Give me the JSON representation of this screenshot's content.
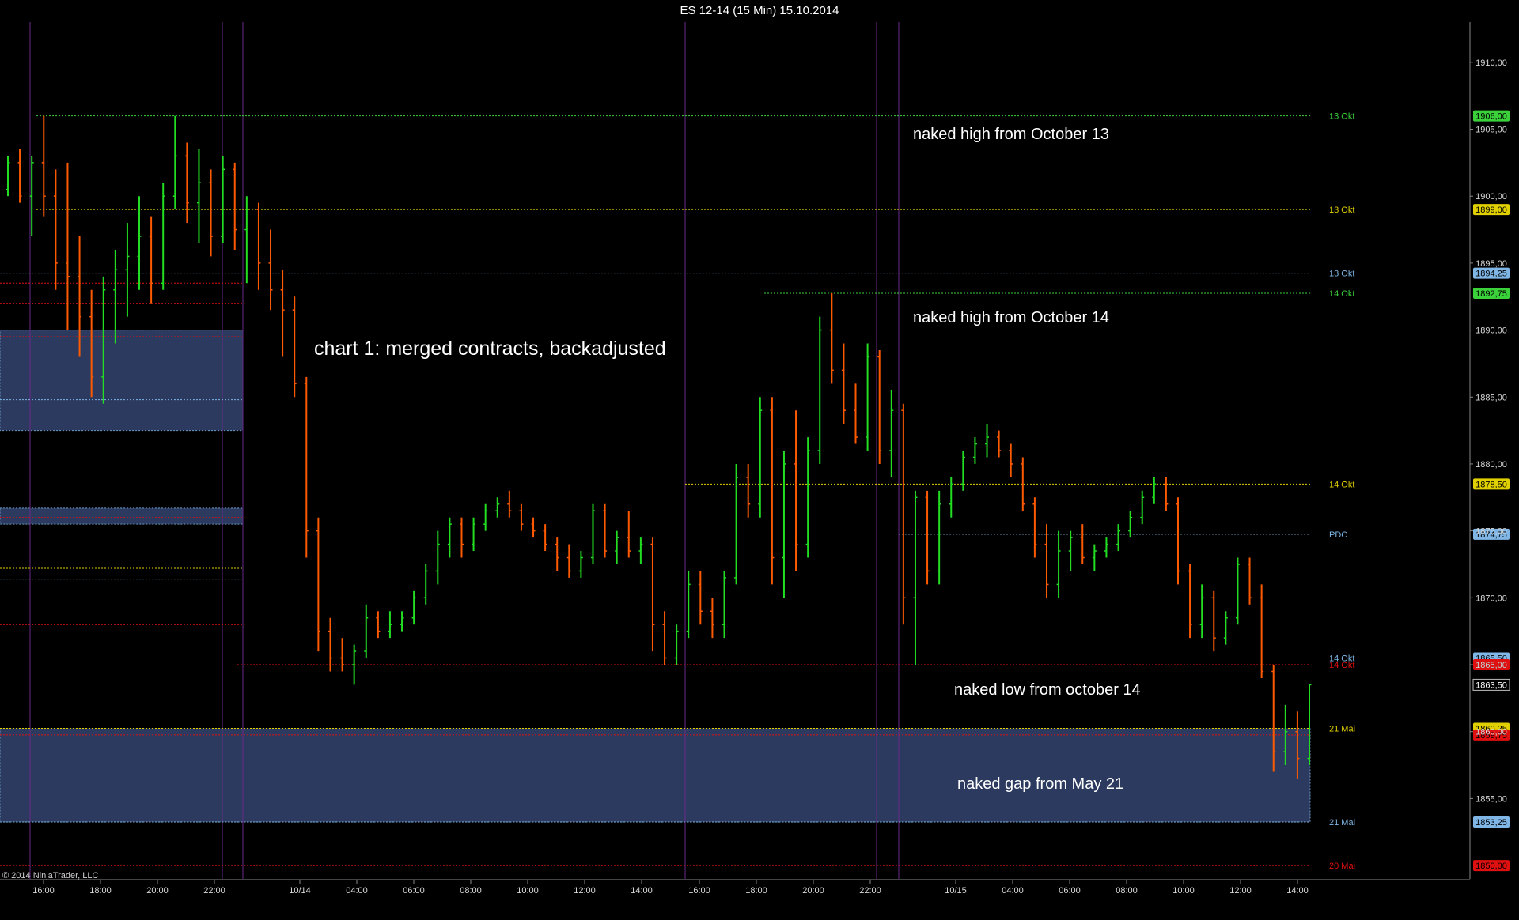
{
  "window": {
    "title": "ES 12-14 (15 Min)  15.10.2014"
  },
  "copyright": "© 2014 NinjaTrader, LLC",
  "colors": {
    "background": "#000000",
    "up_bar": "#22dd22",
    "down_bar": "#ff5a00",
    "neutral_bar": "#ffffff",
    "zone_fill": "#2b3a5e",
    "session_divider": "#6a2a8a",
    "green_level": "#3bd13b",
    "yellow_level": "#e0d000",
    "blue_level": "#7fb6e6",
    "red_level": "#e01010"
  },
  "annotations": {
    "chart_label": "chart 1: merged contracts, backadjusted",
    "naked_high_13": "naked high from October 13",
    "naked_high_14": "naked high from October 14",
    "naked_low_14": "naked low from october 14",
    "naked_gap_may21": "naked gap from May 21"
  },
  "chart_data": {
    "type": "bar",
    "instrument": "ES 12-14",
    "interval": "15 Min",
    "date": "15.10.2014",
    "ylim": [
      1849,
      1913
    ],
    "y_ticks": [
      "1910,00",
      "1905,00",
      "1900,00",
      "1895,00",
      "1890,00",
      "1885,00",
      "1880,00",
      "1875,00",
      "1870,00",
      "1865,00",
      "1860,00",
      "1855,00"
    ],
    "y_tick_values": [
      1910,
      1905,
      1900,
      1895,
      1890,
      1885,
      1880,
      1875,
      1870,
      1865,
      1860,
      1855
    ],
    "x_ticks": [
      "16:00",
      "18:00",
      "20:00",
      "22:00",
      "10/14",
      "04:00",
      "06:00",
      "08:00",
      "10:00",
      "12:00",
      "14:00",
      "16:00",
      "18:00",
      "20:00",
      "22:00",
      "10/15",
      "04:00",
      "06:00",
      "08:00",
      "10:00",
      "12:00",
      "14:00"
    ],
    "levels": [
      {
        "price": 1906.0,
        "label": "13 Okt",
        "price_label": "1906,00",
        "color": "green"
      },
      {
        "price": 1899.0,
        "label": "13 Okt",
        "price_label": "1899,00",
        "color": "yellow"
      },
      {
        "price": 1894.25,
        "label": "13 Okt",
        "price_label": "1894,25",
        "color": "blue"
      },
      {
        "price": 1892.75,
        "label": "14 Okt",
        "price_label": "1892,75",
        "color": "green"
      },
      {
        "price": 1878.5,
        "label": "14 Okt",
        "price_label": "1878,50",
        "color": "yellow"
      },
      {
        "price": 1874.75,
        "label": "PDC",
        "price_label": "1874,75",
        "color": "blue"
      },
      {
        "price": 1865.5,
        "label": "14 Okt",
        "price_label": "1865,50",
        "color": "blue"
      },
      {
        "price": 1865.0,
        "label": "14 Okt",
        "price_label": "1865,00",
        "color": "red"
      },
      {
        "price": 1860.25,
        "label": "21 Mai",
        "price_label": "1860,25",
        "color": "yellow"
      },
      {
        "price": 1859.75,
        "label": "",
        "price_label": "1859,75",
        "color": "red"
      },
      {
        "price": 1853.25,
        "label": "21 Mai",
        "price_label": "1853,25",
        "color": "blue"
      },
      {
        "price": 1850.0,
        "label": "20 Mai",
        "price_label": "1850,00",
        "color": "red"
      }
    ],
    "last_price": 1863.5,
    "last_price_label": "1863,50",
    "zones": [
      {
        "from": 1882.5,
        "to": 1890.0
      },
      {
        "from": 1875.5,
        "to": 1876.7
      },
      {
        "from": 1853.25,
        "to": 1860.25
      }
    ],
    "ohlc": [
      [
        1900.5,
        1903.0,
        1900.0,
        1902.5
      ],
      [
        1902.5,
        1903.5,
        1899.5,
        1900.0
      ],
      [
        1900.0,
        1903.0,
        1897.0,
        1902.5
      ],
      [
        1902.5,
        1906.0,
        1898.5,
        1900.0
      ],
      [
        1900.0,
        1902.0,
        1893.0,
        1895.0
      ],
      [
        1895.0,
        1902.5,
        1890.0,
        1894.0
      ],
      [
        1894.0,
        1897.0,
        1888.0,
        1891.0
      ],
      [
        1891.0,
        1893.0,
        1885.0,
        1886.5
      ],
      [
        1886.5,
        1894.0,
        1884.5,
        1893.0
      ],
      [
        1893.0,
        1896.0,
        1889.0,
        1894.5
      ],
      [
        1894.5,
        1898.0,
        1891.0,
        1895.5
      ],
      [
        1895.5,
        1900.0,
        1893.0,
        1897.0
      ],
      [
        1897.0,
        1898.5,
        1892.0,
        1893.5
      ],
      [
        1893.5,
        1901.0,
        1893.0,
        1900.0
      ],
      [
        1900.0,
        1906.0,
        1899.0,
        1903.0
      ],
      [
        1903.0,
        1904.0,
        1898.0,
        1899.5
      ],
      [
        1899.5,
        1903.5,
        1896.5,
        1901.0
      ],
      [
        1901.0,
        1902.0,
        1895.5,
        1897.0
      ],
      [
        1897.0,
        1903.0,
        1896.5,
        1902.0
      ],
      [
        1902.0,
        1902.5,
        1896.0,
        1897.5
      ],
      [
        1897.5,
        1900.0,
        1893.5,
        1899.0
      ],
      [
        1899.0,
        1899.5,
        1893.0,
        1895.0
      ],
      [
        1895.0,
        1897.5,
        1891.5,
        1893.0
      ],
      [
        1893.0,
        1894.5,
        1888.0,
        1891.5
      ],
      [
        1891.5,
        1892.5,
        1885.0,
        1886.0
      ],
      [
        1886.0,
        1886.5,
        1873.0,
        1875.0
      ],
      [
        1875.0,
        1876.0,
        1866.0,
        1867.5
      ],
      [
        1867.5,
        1868.5,
        1864.5,
        1865.5
      ],
      [
        1865.5,
        1867.0,
        1864.5,
        1865.0
      ],
      [
        1865.0,
        1866.5,
        1863.5,
        1866.0
      ],
      [
        1866.0,
        1869.5,
        1865.5,
        1868.5
      ],
      [
        1868.5,
        1869.0,
        1867.0,
        1867.5
      ],
      [
        1867.5,
        1869.0,
        1867.0,
        1868.0
      ],
      [
        1868.0,
        1869.0,
        1867.5,
        1868.5
      ],
      [
        1868.5,
        1870.5,
        1868.0,
        1870.0
      ],
      [
        1870.0,
        1872.5,
        1869.5,
        1872.0
      ],
      [
        1872.0,
        1875.0,
        1871.0,
        1874.0
      ],
      [
        1874.0,
        1876.0,
        1873.0,
        1875.5
      ],
      [
        1875.5,
        1876.0,
        1873.0,
        1874.0
      ],
      [
        1874.0,
        1876.0,
        1873.5,
        1875.5
      ],
      [
        1875.5,
        1877.0,
        1875.0,
        1876.5
      ],
      [
        1876.5,
        1877.5,
        1876.0,
        1877.0
      ],
      [
        1877.0,
        1878.0,
        1876.0,
        1876.5
      ],
      [
        1876.5,
        1877.0,
        1875.0,
        1875.5
      ],
      [
        1875.5,
        1876.0,
        1874.5,
        1875.0
      ],
      [
        1875.0,
        1875.5,
        1873.5,
        1874.0
      ],
      [
        1874.0,
        1874.5,
        1872.0,
        1873.0
      ],
      [
        1873.0,
        1874.0,
        1871.5,
        1872.0
      ],
      [
        1872.0,
        1873.5,
        1871.5,
        1873.0
      ],
      [
        1873.0,
        1877.0,
        1872.5,
        1876.5
      ],
      [
        1876.5,
        1877.0,
        1873.0,
        1873.5
      ],
      [
        1873.5,
        1875.0,
        1872.5,
        1874.5
      ],
      [
        1874.5,
        1876.5,
        1873.0,
        1873.5
      ],
      [
        1873.5,
        1874.5,
        1872.5,
        1874.0
      ],
      [
        1874.0,
        1874.5,
        1866.0,
        1868.0
      ],
      [
        1868.0,
        1869.0,
        1865.0,
        1865.5
      ],
      [
        1865.5,
        1868.0,
        1865.0,
        1867.5
      ],
      [
        1867.5,
        1872.0,
        1867.0,
        1871.0
      ],
      [
        1871.0,
        1872.0,
        1868.0,
        1869.0
      ],
      [
        1869.0,
        1870.0,
        1867.0,
        1868.0
      ],
      [
        1868.0,
        1872.0,
        1867.0,
        1871.5
      ],
      [
        1871.5,
        1880.0,
        1871.0,
        1879.0
      ],
      [
        1879.0,
        1880.0,
        1876.0,
        1877.0
      ],
      [
        1877.0,
        1885.0,
        1876.0,
        1884.0
      ],
      [
        1884.0,
        1885.0,
        1871.0,
        1873.0
      ],
      [
        1873.0,
        1881.0,
        1870.0,
        1880.0
      ],
      [
        1880.0,
        1884.0,
        1872.0,
        1874.0
      ],
      [
        1874.0,
        1882.0,
        1873.0,
        1881.0
      ],
      [
        1881.0,
        1891.0,
        1880.0,
        1890.0
      ],
      [
        1890.0,
        1892.75,
        1886.0,
        1887.0
      ],
      [
        1887.0,
        1889.0,
        1883.0,
        1884.0
      ],
      [
        1884.0,
        1886.0,
        1881.5,
        1882.0
      ],
      [
        1882.0,
        1889.0,
        1881.0,
        1888.0
      ],
      [
        1888.0,
        1888.5,
        1880.0,
        1881.0
      ],
      [
        1881.0,
        1885.5,
        1879.0,
        1884.0
      ],
      [
        1884.0,
        1884.5,
        1868.0,
        1870.0
      ],
      [
        1870.0,
        1878.0,
        1865.0,
        1877.5
      ],
      [
        1877.5,
        1878.0,
        1871.0,
        1872.0
      ],
      [
        1872.0,
        1878.0,
        1871.0,
        1877.0
      ],
      [
        1877.0,
        1879.0,
        1876.0,
        1878.5
      ],
      [
        1878.5,
        1881.0,
        1878.0,
        1880.5
      ],
      [
        1880.5,
        1882.0,
        1880.0,
        1881.5
      ],
      [
        1881.5,
        1883.0,
        1880.5,
        1882.0
      ],
      [
        1882.0,
        1882.5,
        1880.5,
        1881.0
      ],
      [
        1881.0,
        1881.5,
        1879.0,
        1880.0
      ],
      [
        1880.0,
        1880.5,
        1876.5,
        1877.0
      ],
      [
        1877.0,
        1877.5,
        1873.0,
        1874.0
      ],
      [
        1874.0,
        1875.5,
        1870.0,
        1871.0
      ],
      [
        1871.0,
        1875.0,
        1870.0,
        1873.5
      ],
      [
        1873.5,
        1875.0,
        1872.0,
        1874.5
      ],
      [
        1874.5,
        1875.5,
        1872.5,
        1873.0
      ],
      [
        1873.0,
        1874.0,
        1872.0,
        1873.5
      ],
      [
        1873.5,
        1874.5,
        1873.0,
        1874.0
      ],
      [
        1874.0,
        1875.5,
        1873.5,
        1875.0
      ],
      [
        1875.0,
        1876.5,
        1874.5,
        1876.0
      ],
      [
        1876.0,
        1878.0,
        1875.5,
        1877.5
      ],
      [
        1877.5,
        1879.0,
        1877.0,
        1878.5
      ],
      [
        1878.5,
        1879.0,
        1876.5,
        1877.0
      ],
      [
        1877.0,
        1877.5,
        1871.0,
        1872.0
      ],
      [
        1872.0,
        1872.5,
        1867.0,
        1868.0
      ],
      [
        1868.0,
        1871.0,
        1867.0,
        1870.0
      ],
      [
        1870.0,
        1870.5,
        1866.0,
        1867.0
      ],
      [
        1867.0,
        1869.0,
        1866.5,
        1868.5
      ],
      [
        1868.5,
        1873.0,
        1868.0,
        1872.5
      ],
      [
        1872.5,
        1873.0,
        1869.5,
        1870.0
      ],
      [
        1870.0,
        1871.0,
        1864.0,
        1864.5
      ],
      [
        1864.5,
        1865.0,
        1857.0,
        1858.5
      ],
      [
        1858.5,
        1862.0,
        1857.5,
        1860.0
      ],
      [
        1860.0,
        1861.5,
        1856.5,
        1858.0
      ],
      [
        1858.0,
        1863.5,
        1857.5,
        1863.5
      ]
    ]
  }
}
